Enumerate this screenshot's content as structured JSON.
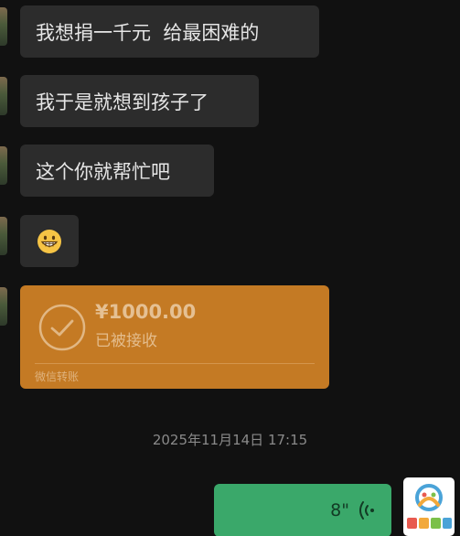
{
  "messages": [
    {
      "text": "我想捐一千元  给最困难的"
    },
    {
      "text": "我于是就想到孩子了"
    },
    {
      "text": "这个你就帮忙吧"
    },
    {
      "emoji": "grinning-face"
    }
  ],
  "transfer": {
    "amount": "¥1000.00",
    "status": "已被接收",
    "footer": "微信转账"
  },
  "timestamp": "2025年11月14日 17:15",
  "voice_message": {
    "duration": "8\""
  },
  "colors": {
    "background": "#111111",
    "incoming_bubble": "#2c2c2c",
    "transfer_bubble": "#c47a24",
    "outgoing_bubble": "#3aa86a"
  },
  "icons": {
    "transfer": "check-circle-icon",
    "voice": "voice-wave-icon",
    "emoji": "grinning-face-icon"
  }
}
